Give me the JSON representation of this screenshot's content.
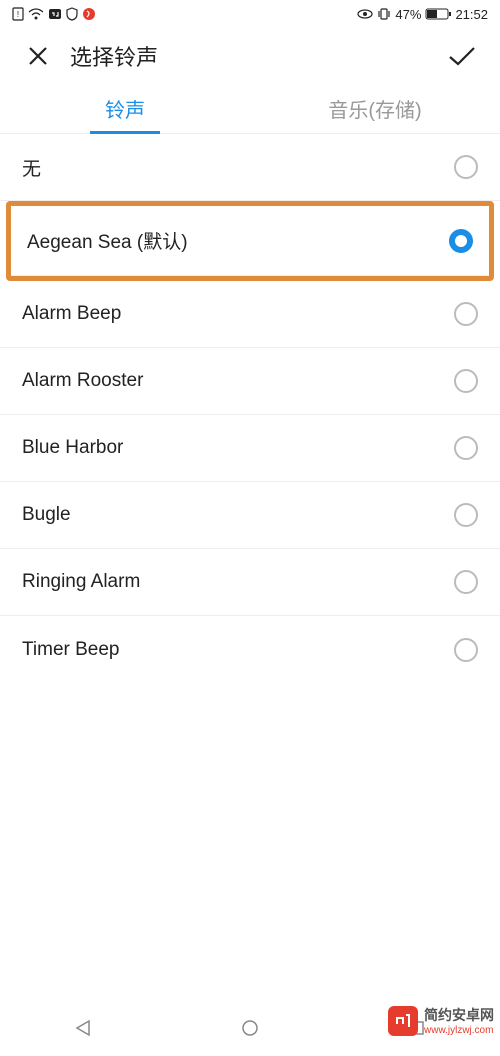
{
  "status_bar": {
    "battery_percent": "47%",
    "time": "21:52"
  },
  "header": {
    "title": "选择铃声"
  },
  "tabs": {
    "active": "铃声",
    "inactive": "音乐(存储)"
  },
  "ringtones": {
    "none": "无",
    "default": "Aegean Sea (默认)",
    "alarm_beep": "Alarm Beep",
    "alarm_rooster": "Alarm Rooster",
    "blue_harbor": "Blue Harbor",
    "bugle": "Bugle",
    "ringing_alarm": "Ringing Alarm",
    "timer_beep": "Timer Beep"
  },
  "watermark": {
    "name": "简约安卓网",
    "url": "www.jylzwj.com"
  }
}
